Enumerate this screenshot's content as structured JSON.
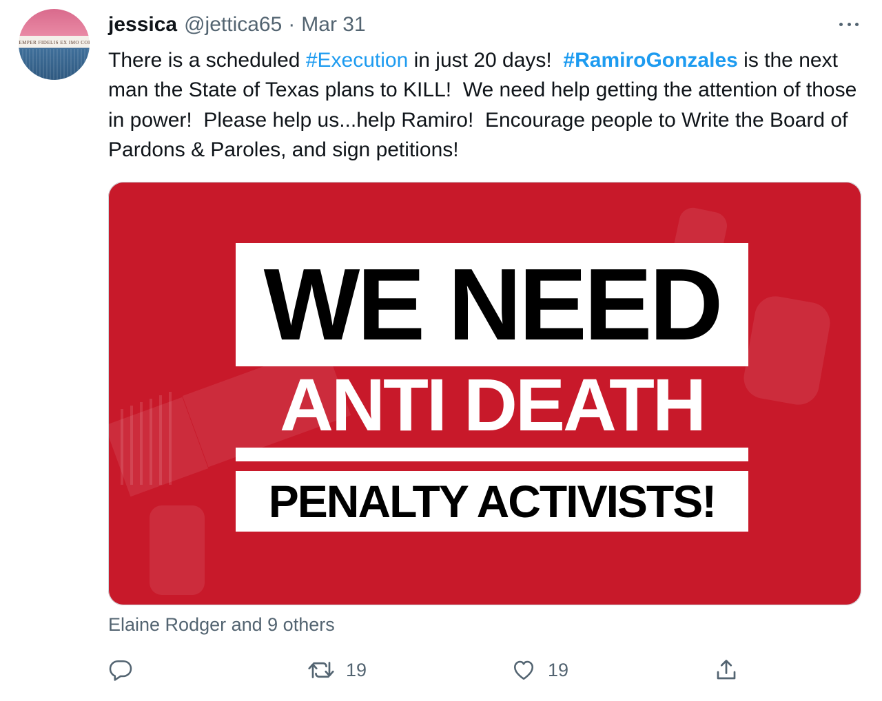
{
  "tweet": {
    "author_name": "jessica",
    "author_handle": "@jettica65",
    "separator": "·",
    "date": "Mar 31",
    "avatar_text": "SEMPER FIDELIS EX IMO CORDE",
    "text_parts": [
      "There is a scheduled ",
      "#Execution",
      " in just 20 days!  ",
      "#RamiroGonzales",
      " is the next man the State of Texas plans to KILL!  We need help getting the attention of those in power!  Please help us...help Ramiro!  Encourage people to Write the Board of Pardons & Paroles, and sign petitions!"
    ],
    "image": {
      "line1": "WE NEED",
      "line2": "ANTI DEATH",
      "line3": "PENALTY ACTIVISTS!",
      "background_color": "#c8192a"
    },
    "liked_by": "Elaine Rodger and 9 others",
    "stats": {
      "retweets": "19",
      "likes": "19"
    }
  },
  "colors": {
    "text": "#0f1419",
    "secondary": "#536471",
    "link": "#1d9bf0"
  },
  "icons": {
    "more": "more-icon",
    "reply": "reply-icon",
    "retweet": "retweet-icon",
    "like": "heart-icon",
    "share": "share-icon"
  }
}
